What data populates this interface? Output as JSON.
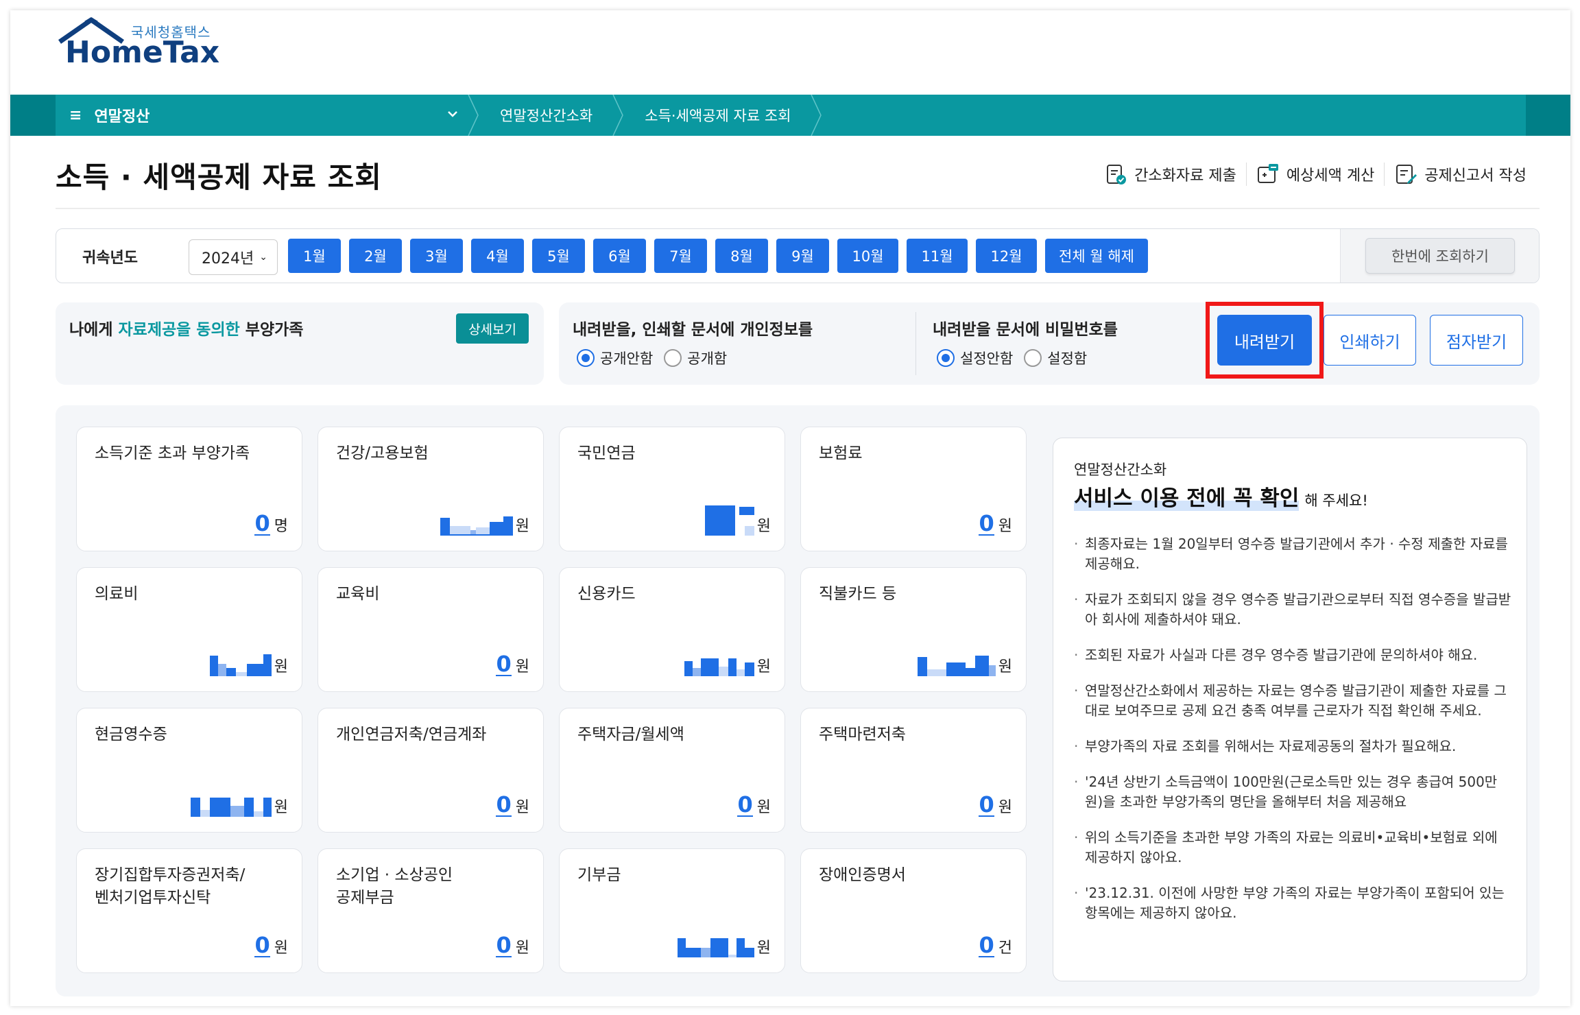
{
  "logo": {
    "subtitle": "국세청홈택스",
    "main": "HomeTax"
  },
  "nav": {
    "menu_label": "연말정산",
    "breadcrumbs": [
      "연말정산간소화",
      "소득·세액공제 자료 조회"
    ]
  },
  "page_title": "소득 · 세액공제 자료 조회",
  "top_actions": [
    {
      "label": "간소화자료 제출",
      "icon": "document-check-icon"
    },
    {
      "label": "예상세액 계산",
      "icon": "calculator-icon"
    },
    {
      "label": "공제신고서 작성",
      "icon": "document-edit-icon"
    }
  ],
  "filter": {
    "year_label": "귀속년도",
    "year_value": "2024년",
    "months": [
      "1월",
      "2월",
      "3월",
      "4월",
      "5월",
      "6월",
      "7월",
      "8월",
      "9월",
      "10월",
      "11월",
      "12월",
      "전체 월 해제"
    ],
    "query_button": "한번에 조회하기"
  },
  "dependents": {
    "text_before": "나에게 ",
    "text_highlight": "자료제공을 동의한",
    "text_after": " 부양가족",
    "detail_button": "상세보기"
  },
  "privacy_option": {
    "title": "내려받을, 인쇄할 문서에 개인정보를",
    "options": [
      "공개안함",
      "공개함"
    ],
    "selected": "공개안함"
  },
  "password_option": {
    "title": "내려받을 문서에 비밀번호를",
    "options": [
      "설정안함",
      "설정함"
    ],
    "selected": "설정안함"
  },
  "actions": {
    "download": "내려받기",
    "print": "인쇄하기",
    "braille": "점자받기"
  },
  "colors": {
    "accent": "#1f6fe5",
    "teal": "#0a98a0",
    "highlight_box": "#f01818"
  },
  "cards": [
    {
      "title": "소득기준 초과 부양가족",
      "value": "0",
      "unit": "명"
    },
    {
      "title": "건강/고용보험",
      "value": "",
      "unit": "원",
      "masked": true
    },
    {
      "title": "국민연금",
      "value": "",
      "unit": "원",
      "masked": true
    },
    {
      "title": "보험료",
      "value": "0",
      "unit": "원"
    },
    {
      "title": "의료비",
      "value": "",
      "unit": "원",
      "masked": true
    },
    {
      "title": "교육비",
      "value": "0",
      "unit": "원"
    },
    {
      "title": "신용카드",
      "value": "",
      "unit": "원",
      "masked": true
    },
    {
      "title": "직불카드 등",
      "value": "",
      "unit": "원",
      "masked": true
    },
    {
      "title": "현금영수증",
      "value": "",
      "unit": "원",
      "masked": true
    },
    {
      "title": "개인연금저축/연금계좌",
      "value": "0",
      "unit": "원"
    },
    {
      "title": "주택자금/월세액",
      "value": "0",
      "unit": "원"
    },
    {
      "title": "주택마련저축",
      "value": "0",
      "unit": "원"
    },
    {
      "title": "장기집합투자증권저축/\n벤처기업투자신탁",
      "value": "0",
      "unit": "원"
    },
    {
      "title": "소기업 · 소상공인\n공제부금",
      "value": "0",
      "unit": "원"
    },
    {
      "title": "기부금",
      "value": "",
      "unit": "원",
      "masked": true
    },
    {
      "title": "장애인증명서",
      "value": "0",
      "unit": "건"
    }
  ],
  "notice": {
    "subtitle": "연말정산간소화",
    "heading": "서비스 이용 전에 꼭 확인",
    "heading_suffix": "해 주세요!",
    "items": [
      "최종자료는 1월 20일부터 영수증 발급기관에서 추가 · 수정 제출한 자료를 제공해요.",
      "자료가 조회되지 않을 경우 영수증 발급기관으로부터 직접 영수증을 발급받아 회사에 제출하셔야 돼요.",
      "조회된 자료가 사실과 다른 경우 영수증 발급기관에 문의하셔야 해요.",
      "연말정산간소화에서 제공하는 자료는 영수증 발급기관이 제출한 자료를 그대로 보여주므로 공제 요건 충족 여부를 근로자가 직접 확인해 주세요.",
      "부양가족의 자료 조회를 위해서는 자료제공동의 절차가 필요해요.",
      "'24년 상반기 소득금액이 100만원(근로소득만 있는 경우 총급여 500만원)을 초과한 부양가족의 명단을 올해부터 처음 제공해요",
      "위의 소득기준을 초과한 부양 가족의 자료는 의료비•교육비•보험료 외에 제공하지 않아요.",
      "'23.12.31. 이전에 사망한 부양 가족의 자료는 부양가족이 포함되어 있는 항목에는 제공하지 않아요."
    ]
  }
}
